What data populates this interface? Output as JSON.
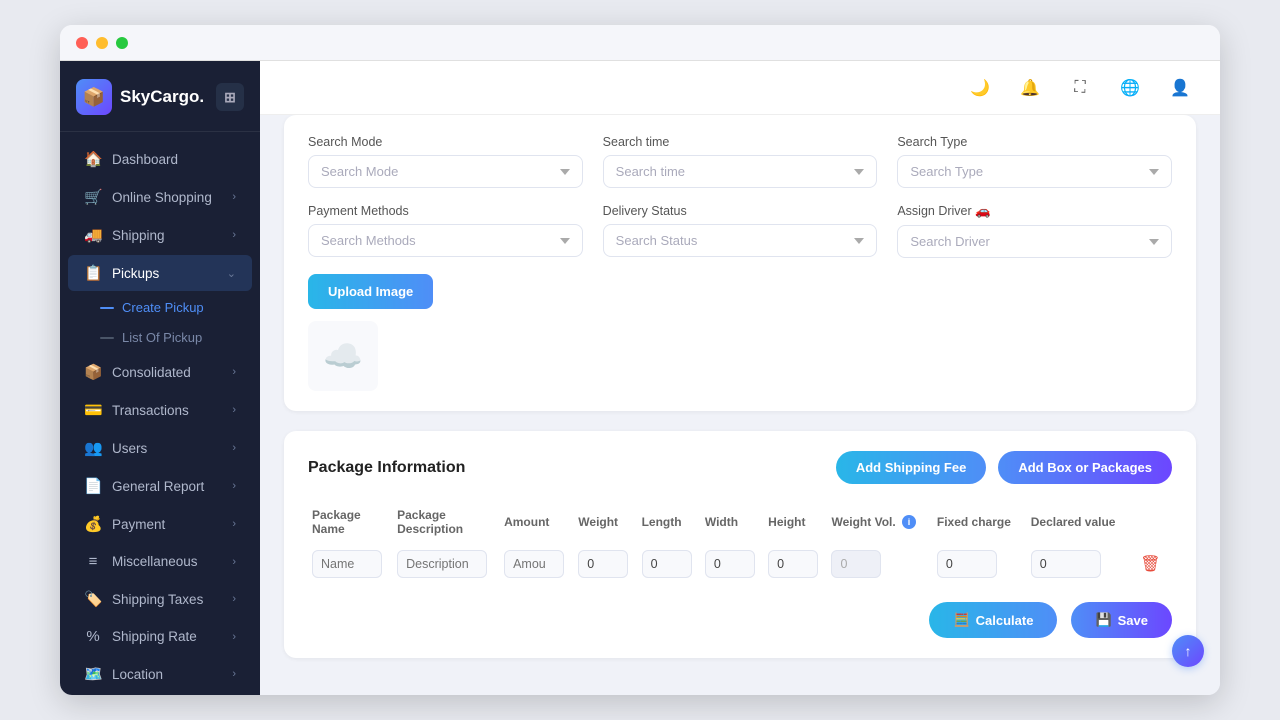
{
  "app": {
    "name": "SkyCargo.",
    "logo_emoji": "📦"
  },
  "sidebar": {
    "items": [
      {
        "id": "dashboard",
        "label": "Dashboard",
        "icon": "🏠",
        "has_chevron": false
      },
      {
        "id": "online-shopping",
        "label": "Online Shopping",
        "icon": "🛒",
        "has_chevron": true
      },
      {
        "id": "shipping",
        "label": "Shipping",
        "icon": "🚚",
        "has_chevron": true
      },
      {
        "id": "pickups",
        "label": "Pickups",
        "icon": "📋",
        "has_chevron": true,
        "active": true
      },
      {
        "id": "consolidated",
        "label": "Consolidated",
        "icon": "📦",
        "has_chevron": true
      },
      {
        "id": "transactions",
        "label": "Transactions",
        "icon": "💳",
        "has_chevron": true
      },
      {
        "id": "users",
        "label": "Users",
        "icon": "👥",
        "has_chevron": true
      },
      {
        "id": "general-report",
        "label": "General Report",
        "icon": "📄",
        "has_chevron": true
      },
      {
        "id": "payment",
        "label": "Payment",
        "icon": "💰",
        "has_chevron": true
      },
      {
        "id": "miscellaneous",
        "label": "Miscellaneous",
        "icon": "≡",
        "has_chevron": true
      },
      {
        "id": "shipping-taxes",
        "label": "Shipping Taxes",
        "icon": "🏷️",
        "has_chevron": true
      },
      {
        "id": "shipping-rate",
        "label": "Shipping Rate",
        "icon": "%",
        "has_chevron": true
      },
      {
        "id": "location",
        "label": "Location",
        "icon": "🗺️",
        "has_chevron": true
      }
    ],
    "sub_items": [
      {
        "id": "create-pickup",
        "label": "Create Pickup",
        "active": true
      },
      {
        "id": "list-of-pickup",
        "label": "List Of Pickup",
        "active": false
      }
    ]
  },
  "topbar": {
    "icons": [
      "moon",
      "bell",
      "expand",
      "globe",
      "user"
    ]
  },
  "filters": {
    "row1": {
      "mode_label": "Search Mode",
      "mode_placeholder": "Search Mode",
      "time_label": "Search time",
      "time_placeholder": "Search time",
      "type_label": "Search Type",
      "type_placeholder": "Search Type"
    },
    "row2": {
      "methods_label": "Payment Methods",
      "methods_placeholder": "Search Methods",
      "status_label": "Delivery Status",
      "status_placeholder": "Search Status",
      "driver_label": "Assign Driver 🚗",
      "driver_placeholder": "Search Driver"
    }
  },
  "upload": {
    "button_label": "Upload Image",
    "preview_icon": "☁️"
  },
  "package": {
    "title": "Package Information",
    "add_shipping_label": "Add Shipping Fee",
    "add_box_label": "Add Box or Packages",
    "table": {
      "columns": [
        "Package Name",
        "Package Description",
        "Amount",
        "Weight",
        "Length",
        "Width",
        "Height",
        "Weight Vol.",
        "Fixed charge",
        "Declared value",
        ""
      ],
      "rows": [
        {
          "name": "",
          "description": "",
          "amount": "",
          "weight": "0",
          "length": "0",
          "width": "0",
          "height": "0",
          "weight_vol": "0",
          "fixed_charge": "0",
          "declared_value": "0"
        }
      ],
      "name_placeholder": "Name",
      "desc_placeholder": "Description",
      "amount_placeholder": "Amou"
    },
    "calculate_label": "Calculate",
    "save_label": "Save"
  }
}
